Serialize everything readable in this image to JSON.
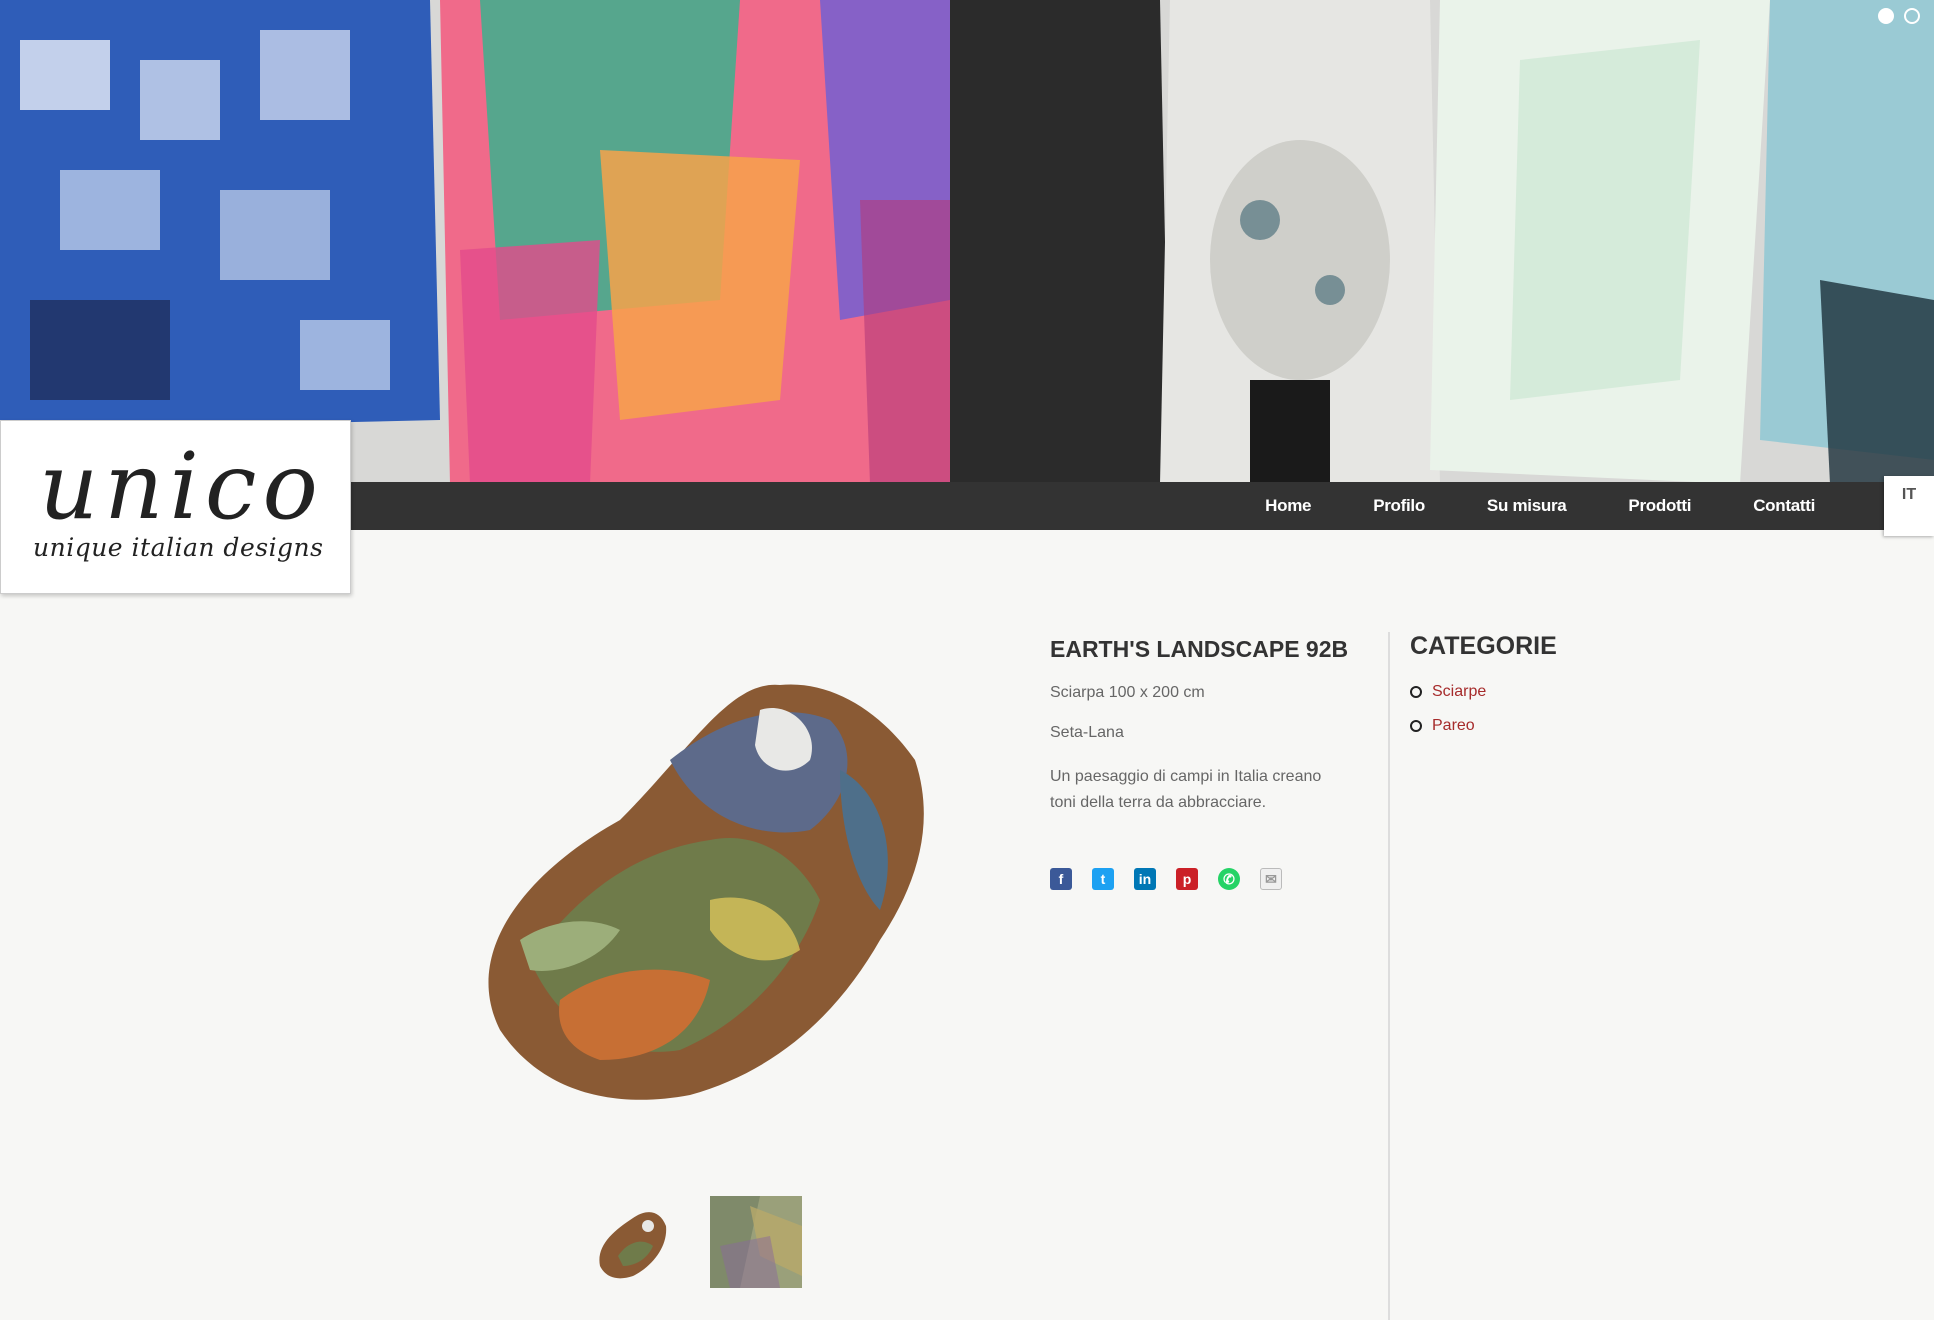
{
  "hero": {
    "slider_dots": [
      {
        "active": true
      },
      {
        "active": false
      }
    ]
  },
  "logo": {
    "main": "unico",
    "tagline": "unique italian designs"
  },
  "nav": {
    "items": [
      "Home",
      "Profilo",
      "Su misura",
      "Prodotti",
      "Contatti"
    ],
    "language": "IT"
  },
  "product": {
    "title": "EARTH'S LANDSCAPE 92B",
    "size": "Sciarpa 100 x 200 cm",
    "material": "Seta-Lana",
    "description": "Un paesaggio di campi in Italia creano toni della terra da abbracciare.",
    "share_icons": [
      "facebook-icon",
      "twitter-icon",
      "linkedin-icon",
      "pinterest-icon",
      "whatsapp-icon",
      "email-icon"
    ]
  },
  "sidebar": {
    "title": "CATEGORIE",
    "categories": [
      "Sciarpe",
      "Pareo"
    ]
  },
  "colors": {
    "navbar": "#333333",
    "link": "#a62b2b",
    "background": "#f7f7f5"
  }
}
